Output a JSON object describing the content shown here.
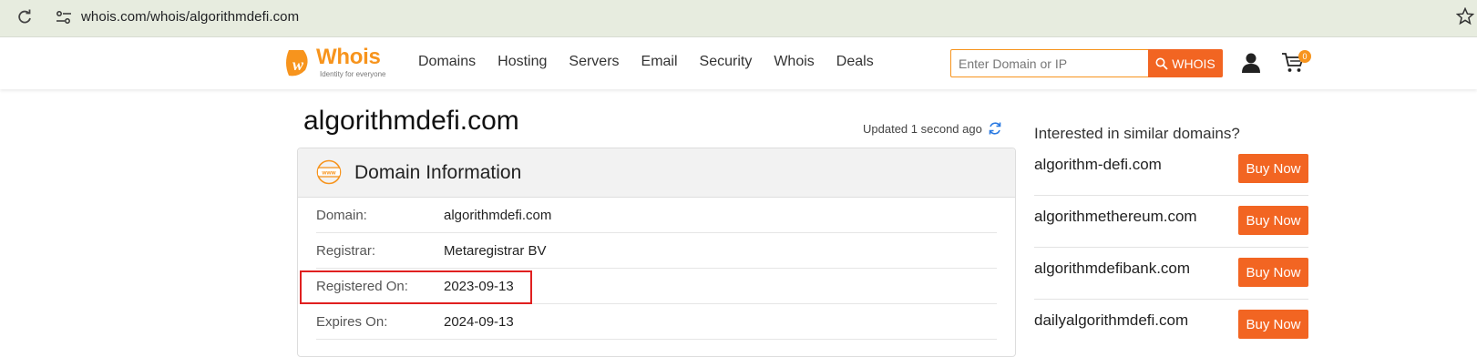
{
  "browser": {
    "url": "whois.com/whois/algorithmdefi.com"
  },
  "header": {
    "logo_text": "Whois",
    "logo_tagline": "Identity for everyone",
    "nav": [
      "Domains",
      "Hosting",
      "Servers",
      "Email",
      "Security",
      "Whois",
      "Deals"
    ],
    "search_placeholder": "Enter Domain or IP",
    "search_button": "WHOIS",
    "cart_count": "0",
    "accent_color": "#f26522"
  },
  "main": {
    "domain_title": "algorithmdefi.com",
    "updated_text": "Updated 1 second ago",
    "card_title": "Domain Information",
    "rows": [
      {
        "label": "Domain:",
        "value": "algorithmdefi.com"
      },
      {
        "label": "Registrar:",
        "value": "Metaregistrar BV"
      },
      {
        "label": "Registered On:",
        "value": "2023-09-13"
      },
      {
        "label": "Expires On:",
        "value": "2024-09-13"
      }
    ]
  },
  "sidebar": {
    "heading": "Interested in similar domains?",
    "suggestions": [
      {
        "name": "algorithm-defi.com",
        "button": "Buy Now"
      },
      {
        "name": "algorithmethereum.com",
        "button": "Buy Now"
      },
      {
        "name": "algorithmdefibank.com",
        "button": "Buy Now"
      },
      {
        "name": "dailyalgorithmdefi.com",
        "button": "Buy Now"
      }
    ]
  }
}
